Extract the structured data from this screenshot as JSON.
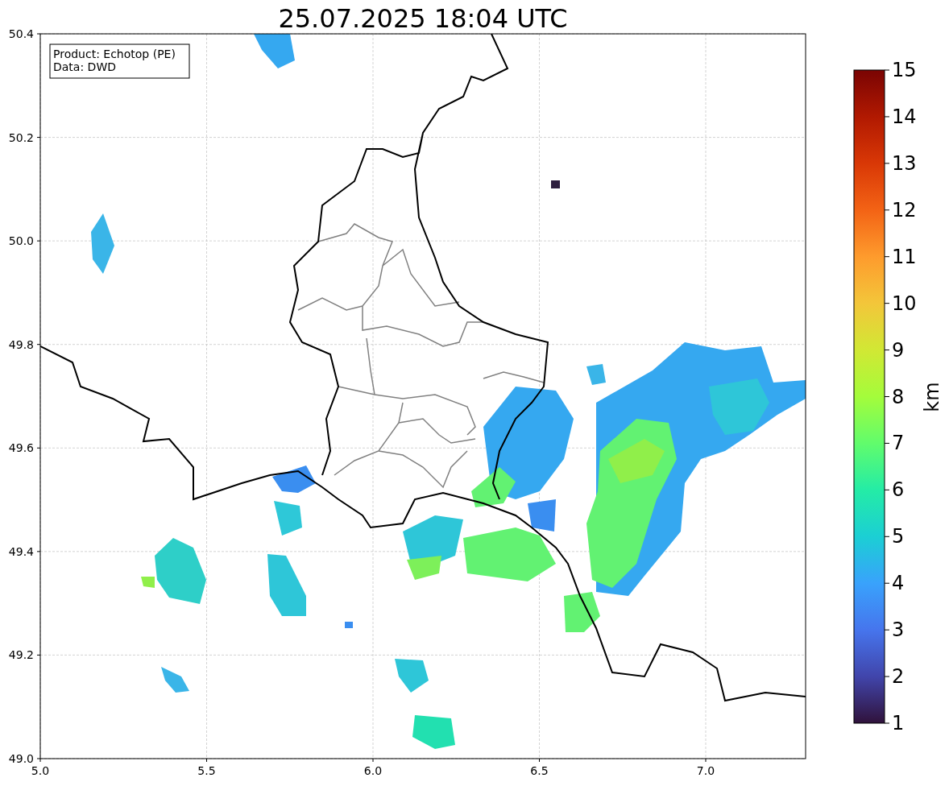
{
  "title": "25.07.2025 18:04 UTC",
  "legend": [
    "Product: Echotop (PE)",
    "Data: DWD"
  ],
  "x_axis": {
    "ticks": [
      "5.0",
      "5.5",
      "6.0",
      "6.5",
      "7.0"
    ]
  },
  "y_axis": {
    "ticks": [
      "50.4",
      "50.2",
      "50.0",
      "49.8",
      "49.6",
      "49.4",
      "49.2",
      "49.0"
    ]
  },
  "colorbar": {
    "label": "km",
    "ticks": [
      "15",
      "14",
      "13",
      "12",
      "11",
      "10",
      "9",
      "8",
      "7",
      "6",
      "5",
      "4",
      "3",
      "2",
      "1"
    ]
  }
}
